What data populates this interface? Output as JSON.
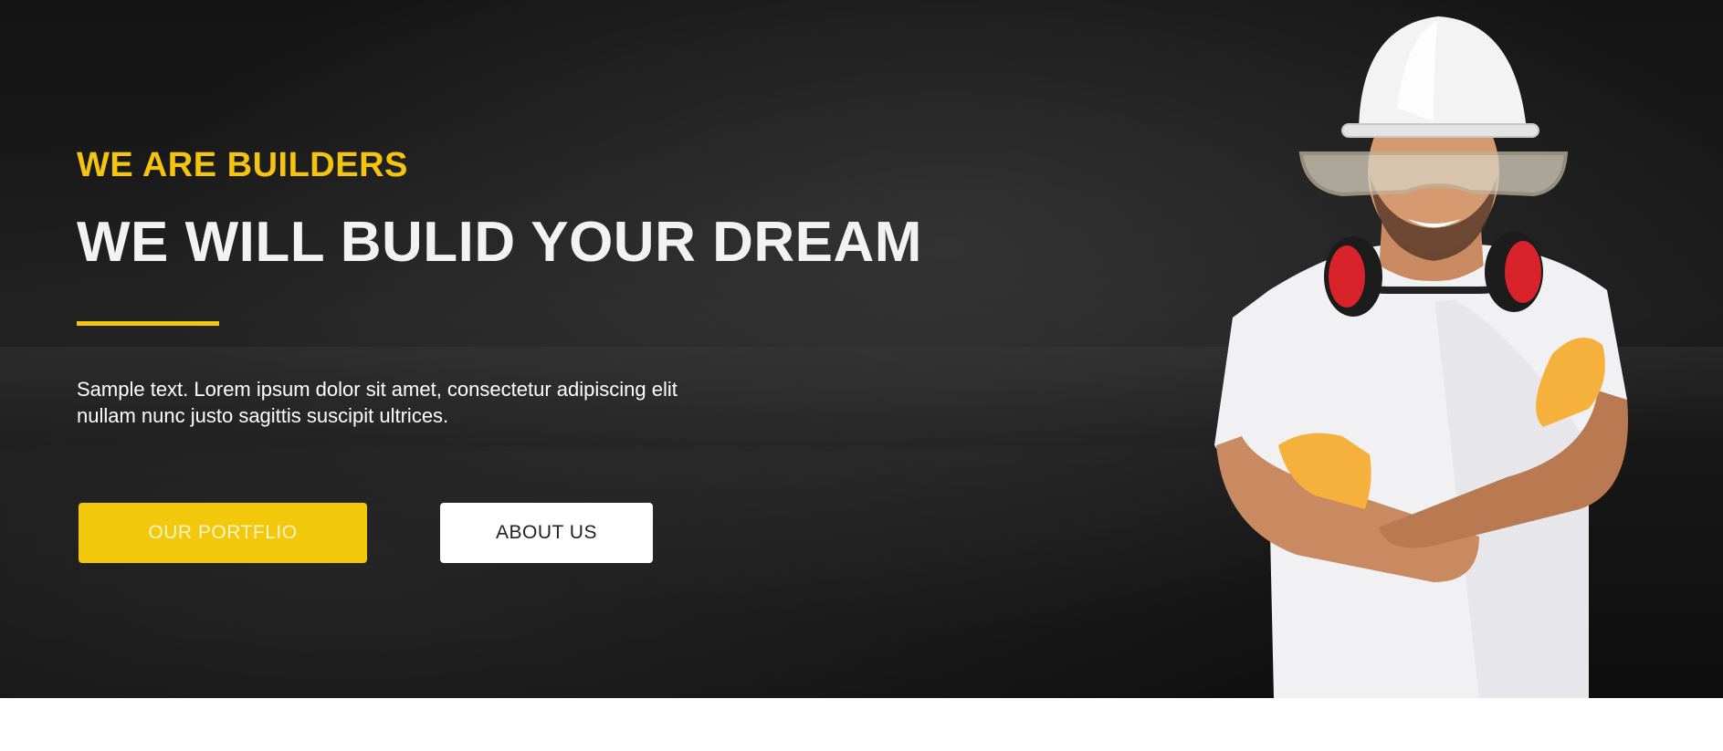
{
  "hero": {
    "subtitle": "WE ARE BUILDERS",
    "title": "WE WILL BULID YOUR DREAM",
    "description": "Sample text. Lorem ipsum dolor sit amet, consectetur adipiscing elit nullam nunc justo sagittis suscipit ultrices.",
    "buttons": {
      "portfolio": "OUR PORTFLIO",
      "about": "ABOUT US"
    },
    "image_icon": "construction-worker-image"
  },
  "colors": {
    "accent": "#f5c40e",
    "background": "#161616",
    "text": "#ffffff"
  }
}
